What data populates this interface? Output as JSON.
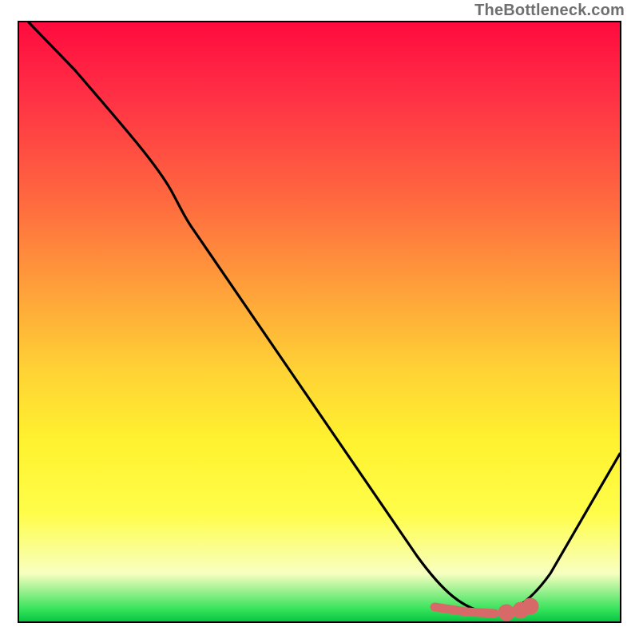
{
  "attribution": "TheBottleneck.com",
  "chart_data": {
    "type": "line",
    "title": "",
    "xlabel": "",
    "ylabel": "",
    "xlim": [
      0,
      100
    ],
    "ylim": [
      0,
      100
    ],
    "series": [
      {
        "name": "bottleneck-curve",
        "x": [
          0,
          10,
          20,
          25,
          30,
          40,
          50,
          60,
          66,
          70,
          75,
          80,
          85,
          90,
          100
        ],
        "y": [
          100,
          88,
          76,
          69,
          62,
          50,
          38,
          26,
          14,
          5,
          1,
          0,
          2,
          10,
          30
        ],
        "color": "#000000"
      },
      {
        "name": "optimal-band-marker",
        "x": [
          70,
          73,
          76,
          80,
          82,
          84
        ],
        "y": [
          2.0,
          1.2,
          1.0,
          1.0,
          1.4,
          2.4
        ],
        "color": "#d96a6a"
      }
    ],
    "gradient_stops": [
      {
        "pos": 0,
        "color": "#ff0b3e"
      },
      {
        "pos": 12,
        "color": "#ff2f45"
      },
      {
        "pos": 30,
        "color": "#ff6a3f"
      },
      {
        "pos": 45,
        "color": "#ffa23a"
      },
      {
        "pos": 58,
        "color": "#ffd235"
      },
      {
        "pos": 70,
        "color": "#fff22f"
      },
      {
        "pos": 82,
        "color": "#fffd4a"
      },
      {
        "pos": 92,
        "color": "#f8ffc0"
      },
      {
        "pos": 98,
        "color": "#36e25a"
      },
      {
        "pos": 100,
        "color": "#08c543"
      }
    ]
  }
}
